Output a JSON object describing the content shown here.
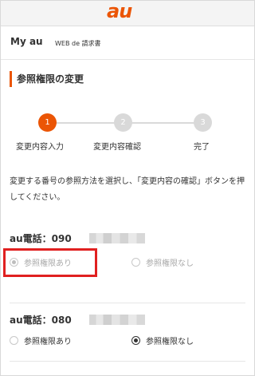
{
  "header": {
    "logo_text": "au"
  },
  "subnav": {
    "my_au": "My au",
    "web_de": "WEB de 請求書"
  },
  "page": {
    "title": "参照権限の変更"
  },
  "steps": [
    {
      "number": "1",
      "label": "変更内容入力",
      "active": true
    },
    {
      "number": "2",
      "label": "変更内容確認",
      "active": false
    },
    {
      "number": "3",
      "label": "完了",
      "active": false
    }
  ],
  "instruction": "変更する番号の参照方法を選択し、「変更内容の確認」ボタンを押してください。",
  "lines": [
    {
      "label": "au電話：090",
      "options": [
        {
          "label": "参照権限あり",
          "checked": true,
          "disabled": true
        },
        {
          "label": "参照権限なし",
          "checked": false,
          "disabled": true
        }
      ]
    },
    {
      "label": "au電話：080",
      "options": [
        {
          "label": "参照権限あり",
          "checked": false,
          "disabled": false
        },
        {
          "label": "参照権限なし",
          "checked": true,
          "disabled": false
        }
      ]
    }
  ],
  "colors": {
    "accent": "#eb5505",
    "highlight": "#e02020",
    "step_inactive": "#d9d9d9"
  }
}
